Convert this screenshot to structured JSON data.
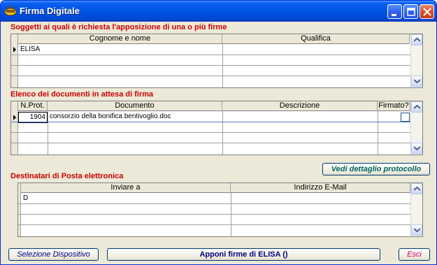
{
  "window": {
    "title": "Firma Digitale"
  },
  "signers": {
    "title": "Soggetti ai quali è richiesta l'apposizione di una o più firme",
    "columns": [
      "Cognome e nome",
      "Qualifica"
    ],
    "rows": [
      [
        "ELISA",
        ""
      ]
    ]
  },
  "documents": {
    "title": "Elenco dei documenti in attesa di firma",
    "columns": [
      "N.Prot.",
      "Documento",
      "Descrizione",
      "Firmato?"
    ],
    "rows": [
      [
        "1904",
        "consorzio della bonifica bentivoglio.doc",
        "",
        ""
      ]
    ]
  },
  "recipients": {
    "title": "Destinatari di Posta elettronica",
    "columns": [
      "Inviare a",
      "Indirizzo E-Mail"
    ],
    "rows": [
      [
        "D",
        ""
      ]
    ]
  },
  "buttons": {
    "dettaglio": "Vedi dettaglio protocollo",
    "selezione": "Selezione Dispositivo",
    "apponi": "Apponi firme di ELISA ()",
    "esci": "Esci"
  },
  "colors": {
    "section_title": "#cc0000",
    "titlebar": "#0055e5"
  }
}
